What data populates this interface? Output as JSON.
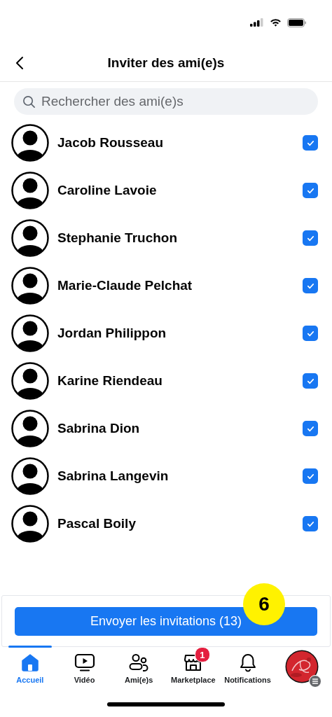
{
  "header": {
    "title": "Inviter des ami(e)s"
  },
  "search": {
    "placeholder": "Rechercher des ami(e)s"
  },
  "friends": [
    {
      "name": "Jacob Rousseau",
      "checked": true
    },
    {
      "name": "Caroline Lavoie",
      "checked": true
    },
    {
      "name": "Stephanie Truchon",
      "checked": true
    },
    {
      "name": "Marie-Claude Pelchat",
      "checked": true
    },
    {
      "name": "Jordan Philippon",
      "checked": true
    },
    {
      "name": "Karine Riendeau",
      "checked": true
    },
    {
      "name": "Sabrina Dion",
      "checked": true
    },
    {
      "name": "Sabrina Langevin",
      "checked": true
    },
    {
      "name": "Pascal Boily",
      "checked": true
    }
  ],
  "send_button": {
    "label": "Envoyer les invitations (13)"
  },
  "step_badge": "6",
  "tab_bar": [
    {
      "kind": "home",
      "label": "Accueil",
      "selected": true
    },
    {
      "kind": "video",
      "label": "Vidéo",
      "selected": false
    },
    {
      "kind": "friends",
      "label": "Ami(e)s",
      "selected": false
    },
    {
      "kind": "marketplace",
      "label": "Marketplace",
      "selected": false,
      "badge": "1"
    },
    {
      "kind": "bell",
      "label": "Notifications",
      "selected": false
    },
    {
      "kind": "profile",
      "selected": false
    }
  ]
}
